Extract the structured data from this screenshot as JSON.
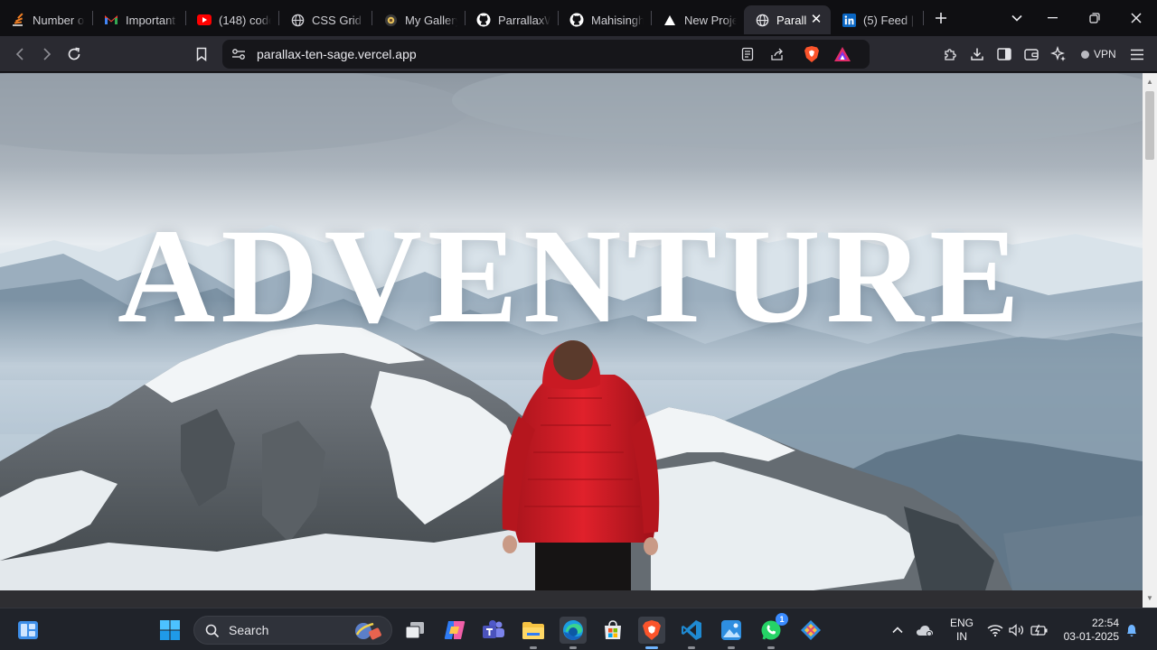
{
  "browser": {
    "tabs": [
      {
        "title": "Number of",
        "icon": "stack-overflow-icon",
        "color": "#f48024"
      },
      {
        "title": "Important",
        "icon": "gmail-icon",
        "color": "#ea4335"
      },
      {
        "title": "(148) code",
        "icon": "youtube-icon",
        "color": "#ff0000"
      },
      {
        "title": "CSS Grid",
        "icon": "globe-icon",
        "color": "#cfcfd4"
      },
      {
        "title": "My Gallery",
        "icon": "gallery-icon",
        "color": "#e8c25a"
      },
      {
        "title": "ParrallaxW",
        "icon": "github-icon",
        "color": "#ffffff"
      },
      {
        "title": "Mahisingh",
        "icon": "github-icon",
        "color": "#ffffff"
      },
      {
        "title": "New Proje",
        "icon": "vercel-icon",
        "color": "#ffffff"
      },
      {
        "title": "Parall",
        "icon": "globe-icon",
        "color": "#cfcfd4",
        "active": true
      },
      {
        "title": "(5) Feed |",
        "icon": "linkedin-icon",
        "color": "#0a66c2"
      }
    ],
    "url": "parallax-ten-sage.vercel.app",
    "vpn_label": "VPN"
  },
  "page": {
    "hero_title": "ADVENTURE"
  },
  "taskbar": {
    "search_label": "Search",
    "language": "ENG",
    "region": "IN",
    "time": "22:54",
    "date": "03-01-2025",
    "whatsapp_badge": "1"
  }
}
